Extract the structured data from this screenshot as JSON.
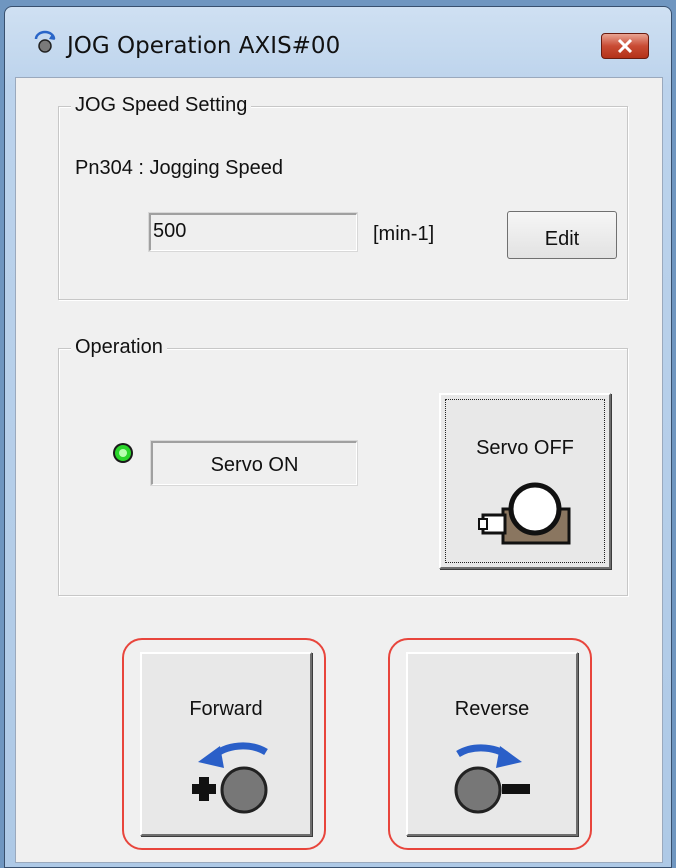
{
  "window": {
    "title": "JOG Operation AXIS#00",
    "title_icon": "rotate-icon",
    "close_icon": "close-icon"
  },
  "jog_speed": {
    "group_label": "JOG Speed Setting",
    "param_label": "Pn304 : Jogging Speed",
    "value": "500",
    "unit": "[min-1]",
    "edit_label": "Edit"
  },
  "operation": {
    "group_label": "Operation",
    "status_text": "Servo ON",
    "status_color": "#2bd62b",
    "servo_button_label": "Servo OFF",
    "servo_icon": "motor-icon"
  },
  "jog_buttons": {
    "forward_label": "Forward",
    "reverse_label": "Reverse",
    "highlight_color": "#e8453c"
  }
}
